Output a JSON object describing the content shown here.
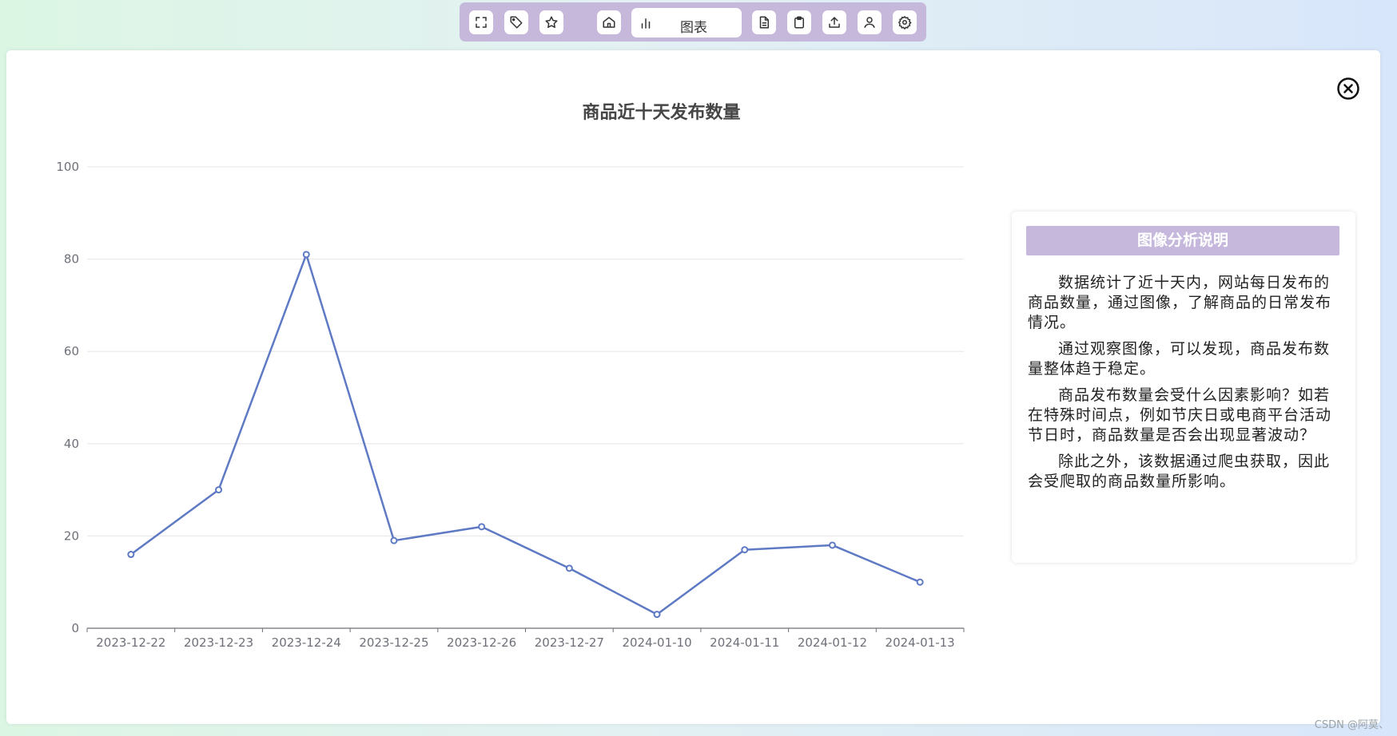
{
  "toolbar": {
    "items": [
      {
        "name": "fullscreen-icon"
      },
      {
        "name": "tag-icon"
      },
      {
        "name": "star-icon"
      },
      {
        "name": "home-icon"
      },
      {
        "name": "bar-chart-icon",
        "label": "图表",
        "active": true
      },
      {
        "name": "document-icon"
      },
      {
        "name": "clipboard-icon"
      },
      {
        "name": "upload-icon"
      },
      {
        "name": "user-icon"
      },
      {
        "name": "gear-icon"
      }
    ],
    "active_label": "图表"
  },
  "close_icon": "close-circle-icon",
  "chart_data": {
    "type": "line",
    "title": "商品近十天发布数量",
    "categories": [
      "2023-12-22",
      "2023-12-23",
      "2023-12-24",
      "2023-12-25",
      "2023-12-26",
      "2023-12-27",
      "2024-01-10",
      "2024-01-11",
      "2024-01-12",
      "2024-01-13"
    ],
    "values": [
      16,
      30,
      81,
      19,
      22,
      13,
      3,
      17,
      18,
      10
    ],
    "ylim": [
      0,
      100
    ],
    "yticks": [
      0,
      20,
      40,
      60,
      80,
      100
    ],
    "grid": true,
    "color": "#5f7ac4"
  },
  "panel": {
    "title": "图像分析说明",
    "paragraphs": [
      "数据统计了近十天内，网站每日发布的商品数量，通过图像，了解商品的日常发布情况。",
      "通过观察图像，可以发现，商品发布数量整体趋于稳定。",
      "商品发布数量会受什么因素影响？如若在特殊时间点，例如节庆日或电商平台活动节日时，商品数量是否会出现显著波动？",
      "除此之外，该数据通过爬虫获取，因此会受爬取的商品数量所影响。"
    ]
  },
  "watermark": "CSDN @阿莫、"
}
